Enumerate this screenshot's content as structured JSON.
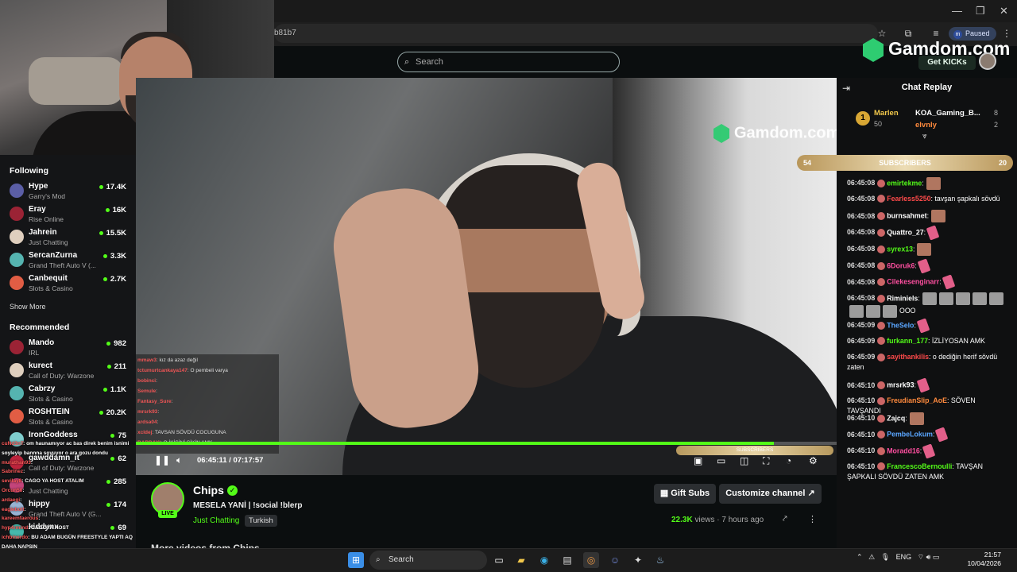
{
  "browser": {
    "url_fragment": "b81b7",
    "paused_label": "Paused",
    "profile_initial": "m"
  },
  "header": {
    "search_placeholder": "Search",
    "sponsor": "Gamdom.com",
    "get_kicks": "Get KICKs"
  },
  "sidebar": {
    "following_title": "Following",
    "following": [
      {
        "name": "Hype",
        "category": "Garry's Mod",
        "viewers": "17.4K"
      },
      {
        "name": "Eray",
        "category": "Rise Online",
        "viewers": "16K"
      },
      {
        "name": "Jahrein",
        "category": "Just Chatting",
        "viewers": "15.5K"
      },
      {
        "name": "SercanZurna",
        "category": "Grand Theft Auto V (...",
        "viewers": "3.3K"
      },
      {
        "name": "Canbequit",
        "category": "Slots & Casino",
        "viewers": "2.7K"
      }
    ],
    "show_more": "Show More",
    "recommended_title": "Recommended",
    "recommended": [
      {
        "name": "Mando",
        "category": "IRL",
        "viewers": "982"
      },
      {
        "name": "kurect",
        "category": "Call of Duty: Warzone",
        "viewers": "211"
      },
      {
        "name": "Cabrzy",
        "category": "Slots & Casino",
        "viewers": "1.1K"
      },
      {
        "name": "ROSHTEIN",
        "category": "Slots & Casino",
        "viewers": "20.2K"
      },
      {
        "name": "IronGoddess",
        "category": "",
        "viewers": "75"
      },
      {
        "name": "gawddamn_it",
        "category": "Call of Duty: Warzone",
        "viewers": "62"
      },
      {
        "name": "",
        "category": "Just Chatting",
        "viewers": "285"
      },
      {
        "name": "hippy",
        "category": "Grand Theft Auto V (G...",
        "viewers": "174"
      },
      {
        "name": "kiddynx",
        "category": "",
        "viewers": "69"
      }
    ]
  },
  "video": {
    "watermark": "Gamdom.com",
    "time_current": "06:45:11",
    "time_total": "07:17:57",
    "progress_fraction": 0.91,
    "subs_bar_label": "SUBSCRIBERS",
    "inner_chat": [
      {
        "user": "mmaw3",
        "text": ": kız da azaz değil"
      },
      {
        "user": "tctumurtcankaya147",
        "text": ": O pembeli varya"
      },
      {
        "user": "bobinci",
        "text": ":"
      },
      {
        "user": "Semule",
        "text": ":"
      },
      {
        "user": "Fantasy_Sure",
        "text": ":"
      },
      {
        "user": "mrsrk93",
        "text": ":"
      },
      {
        "user": "ardsa04",
        "text": ":"
      },
      {
        "user": "xcldej",
        "text": ": TAVSAN SÖVDÜ COCUGUNA"
      },
      {
        "user": "BARDAYI",
        "text": ": O İKİSİNİ SİKİN AMK"
      }
    ]
  },
  "channel": {
    "name": "Chips",
    "live": "LIVE",
    "stream_title": "MESELA YANİ | !social !blerp",
    "category": "Just Chatting",
    "tag": "Turkish",
    "gift_subs": "Gift Subs",
    "customize": "Customize channel",
    "views": "22.3K",
    "views_label": "views",
    "time_ago": "7 hours ago",
    "more_videos": "More videos from Chips"
  },
  "chat": {
    "title": "Chat Replay",
    "top_gifters": [
      {
        "rank": "1",
        "name": "Marlen",
        "count": "50"
      },
      {
        "name": "KOA_Gaming_B...",
        "count": "8"
      },
      {
        "name": "elvnly",
        "count": "2"
      }
    ],
    "sub_bar": {
      "left": "54",
      "label": "SUBSCRIBERS",
      "right": "20"
    },
    "messages": [
      {
        "time": "06:45:08",
        "user": "emirtekme",
        "color": "#53fc18",
        "text": ":",
        "emotes": "e"
      },
      {
        "time": "06:45:08",
        "user": "Fearless5250",
        "color": "#ff4a4a",
        "text": ": tavşan şapkalı sövdü",
        "emotes": ""
      },
      {
        "time": "06:45:08",
        "user": "burnsahmet",
        "color": "#ffffff",
        "text": ":",
        "emotes": "e"
      },
      {
        "time": "06:45:08",
        "user": "Quattro_27",
        "color": "#ffffff",
        "text": ":",
        "emotes": "p"
      },
      {
        "time": "06:45:08",
        "user": "syrex13",
        "color": "#53fc18",
        "text": ":",
        "emotes": "e"
      },
      {
        "time": "06:45:08",
        "user": "6Doruk6",
        "color": "#ff4fa0",
        "text": ":",
        "emotes": "p"
      },
      {
        "time": "06:45:08",
        "user": "Cilekesenginarr",
        "color": "#ff4fa0",
        "text": ":",
        "emotes": "p"
      },
      {
        "time": "06:45:08",
        "user": "Riminiels",
        "color": "#ffffff",
        "text": ":",
        "emotes": "gggggggg",
        "extra": "OOO"
      },
      {
        "time": "06:45:09",
        "user": "TheSelo",
        "color": "#5aa6ff",
        "text": ":",
        "emotes": "p"
      },
      {
        "time": "06:45:09",
        "user": "furkann_177",
        "color": "#53fc18",
        "text": ": İZLİYOSAN AMK",
        "emotes": ""
      },
      {
        "time": "06:45:09",
        "user": "sayithankilis",
        "color": "#ff4a4a",
        "text": ": o dediğin herif sövdü zaten",
        "emotes": ""
      },
      {
        "time": "06:45:10",
        "user": "mrsrk93",
        "color": "#ffffff",
        "text": ":",
        "emotes": "p"
      },
      {
        "time": "06:45:10",
        "user": "FreudianSlip_AoE",
        "color": "#ff8a3d",
        "text": ": SÖVEN TAVŞANDI",
        "emotes": ""
      },
      {
        "time": "06:45:10",
        "user": "Zajcq",
        "color": "#ffffff",
        "text": ":",
        "emotes": "e"
      },
      {
        "time": "06:45:10",
        "user": "PembeLokum",
        "color": "#5aa6ff",
        "text": ":",
        "emotes": "p"
      },
      {
        "time": "06:45:10",
        "user": "Moradd16",
        "color": "#ff4fa0",
        "text": ":",
        "emotes": "p"
      },
      {
        "time": "06:45:10",
        "user": "FrancescoBernoulli",
        "color": "#53fc18",
        "text": ": TAVŞAN ŞAPKALI SÖVDÜ ZATEN AMK",
        "emotes": ""
      }
    ]
  },
  "overlay_chat": [
    {
      "user": "cuNd3nT",
      "text": ": om haunamıyor ac bas direk benim isnimi"
    },
    {
      "user": "",
      "text": "soyleyip bannna soyuyor o ara gozu dondu"
    },
    {
      "user": "murathan93",
      "text": ":"
    },
    {
      "user": "Sabrinez",
      "text": ":"
    },
    {
      "user": "sevilay8",
      "text": ": CAGO YA HOST ATALIM"
    },
    {
      "user": "Orcun50",
      "text": ":"
    },
    {
      "user": "ardaegi",
      "text": ":"
    },
    {
      "user": "eaglebolt",
      "text": ":"
    },
    {
      "user": "kareemfaerous",
      "text": ":"
    },
    {
      "user": "hyp4rmind",
      "text": ": CAGOYA HOST"
    },
    {
      "user": "ichbinerdo",
      "text": ": BU ADAM BUGÜN FREESTYLE YAPTI AQ"
    },
    {
      "user": "",
      "text": "DAHA NAPSIN"
    },
    {
      "user": "ardaegi",
      "text": ":"
    }
  ],
  "taskbar": {
    "search_placeholder": "Search",
    "lang": "ENG",
    "time": "21:57",
    "date": "10/04/2026"
  }
}
